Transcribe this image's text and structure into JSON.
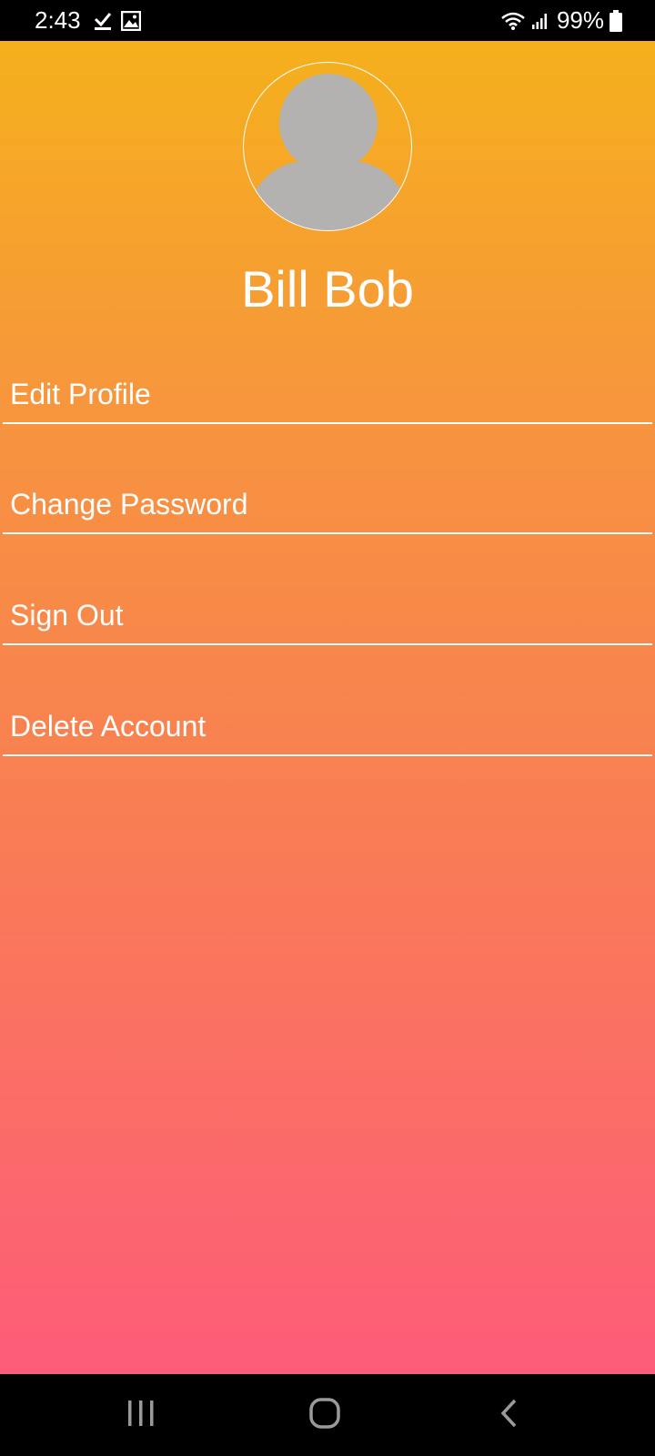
{
  "status_bar": {
    "time": "2:43",
    "battery_percent": "99%",
    "icons": [
      "check-icon",
      "image-icon",
      "wifi-icon",
      "signal-icon",
      "battery-icon"
    ]
  },
  "profile": {
    "name": "Bill Bob",
    "avatar_icon": "default-avatar-icon"
  },
  "menu": {
    "items": [
      {
        "label": "Edit Profile"
      },
      {
        "label": "Change Password"
      },
      {
        "label": "Sign Out"
      },
      {
        "label": "Delete Account"
      }
    ]
  },
  "nav_bar": {
    "icons": [
      "recent-apps-icon",
      "home-icon",
      "back-icon"
    ]
  },
  "colors": {
    "gradient_top": "#f5b01c",
    "gradient_bottom": "#fd5c79",
    "text": "#ffffff",
    "avatar_gray": "#b4b2b1"
  }
}
